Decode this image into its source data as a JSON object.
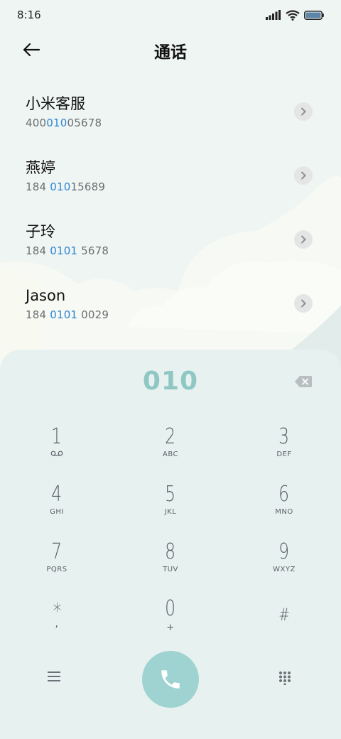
{
  "status_bar": {
    "time": "8:16",
    "icons": [
      "signal-icon",
      "wifi-icon",
      "battery-icon"
    ]
  },
  "header": {
    "back_icon": "back-arrow-icon",
    "title": "通话"
  },
  "contacts": [
    {
      "name": "小米客服",
      "number_pre": "400",
      "number_match": "010",
      "number_post": "05678"
    },
    {
      "name": "燕婷",
      "number_pre": "184 ",
      "number_match": "010",
      "number_post": "15689"
    },
    {
      "name": "子玲",
      "number_pre": "184 ",
      "number_match": "0101",
      "number_post": " 5678"
    },
    {
      "name": "Jason",
      "number_pre": "184 ",
      "number_match": "0101",
      "number_post": " 0029"
    }
  ],
  "dialpad": {
    "input_value": "010",
    "keys": [
      {
        "digit": "1",
        "letters": "voicemail-icon"
      },
      {
        "digit": "2",
        "letters": "ABC"
      },
      {
        "digit": "3",
        "letters": "DEF"
      },
      {
        "digit": "4",
        "letters": "GHI"
      },
      {
        "digit": "5",
        "letters": "JKL"
      },
      {
        "digit": "6",
        "letters": "MNO"
      },
      {
        "digit": "7",
        "letters": "PQRS"
      },
      {
        "digit": "8",
        "letters": "TUV"
      },
      {
        "digit": "9",
        "letters": "WXYZ"
      },
      {
        "digit": "*",
        "letters": ","
      },
      {
        "digit": "0",
        "letters": "+"
      },
      {
        "digit": "#",
        "letters": ""
      }
    ]
  },
  "colors": {
    "accent": "#9fd3d2",
    "highlight": "#2f86d4",
    "dialpad_bg": "#e7f1ef",
    "page_bg": "#f0f6f3"
  }
}
